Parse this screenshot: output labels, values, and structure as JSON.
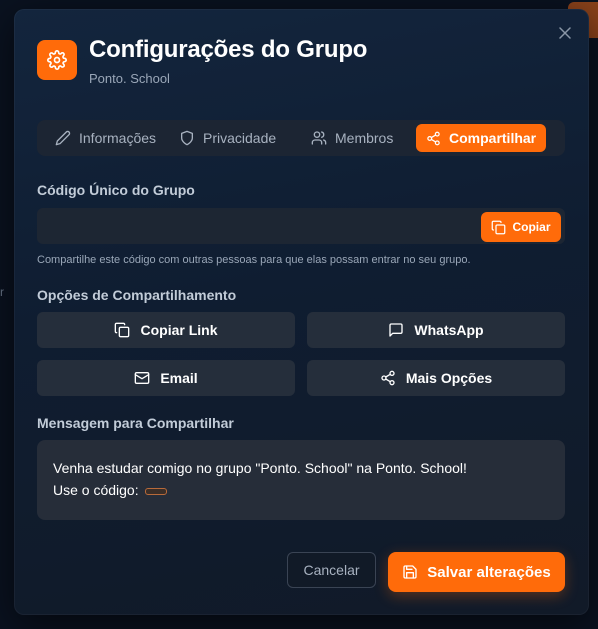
{
  "dialog": {
    "title": "Configurações do Grupo",
    "subtitle": "Ponto. School"
  },
  "tabs": [
    {
      "label": "Informações",
      "icon": "pencil-icon",
      "active": false
    },
    {
      "label": "Privacidade",
      "icon": "shield-icon",
      "active": false
    },
    {
      "label": "Membros",
      "icon": "users-icon",
      "active": false
    },
    {
      "label": "Compartilhar",
      "icon": "share-icon",
      "active": true
    }
  ],
  "code_section": {
    "label": "Código Único do Grupo",
    "value": "",
    "copy_label": "Copiar",
    "hint": "Compartilhe este código com outras pessoas para que elas possam entrar no seu grupo."
  },
  "share_options": {
    "label": "Opções de Compartilhamento",
    "buttons": [
      {
        "label": "Copiar Link",
        "icon": "copy-icon"
      },
      {
        "label": "WhatsApp",
        "icon": "message-icon"
      },
      {
        "label": "Email",
        "icon": "mail-icon"
      },
      {
        "label": "Mais Opções",
        "icon": "share-icon"
      }
    ]
  },
  "message": {
    "label": "Mensagem para Compartilhar",
    "line1": "Venha estudar comigo no grupo \"Ponto. School\" na Ponto. School!",
    "line2": "Use o código:"
  },
  "footer": {
    "cancel_label": "Cancelar",
    "save_label": "Salvar alterações"
  },
  "colors": {
    "accent": "#ff6b0a",
    "background": "#0f1d31"
  }
}
